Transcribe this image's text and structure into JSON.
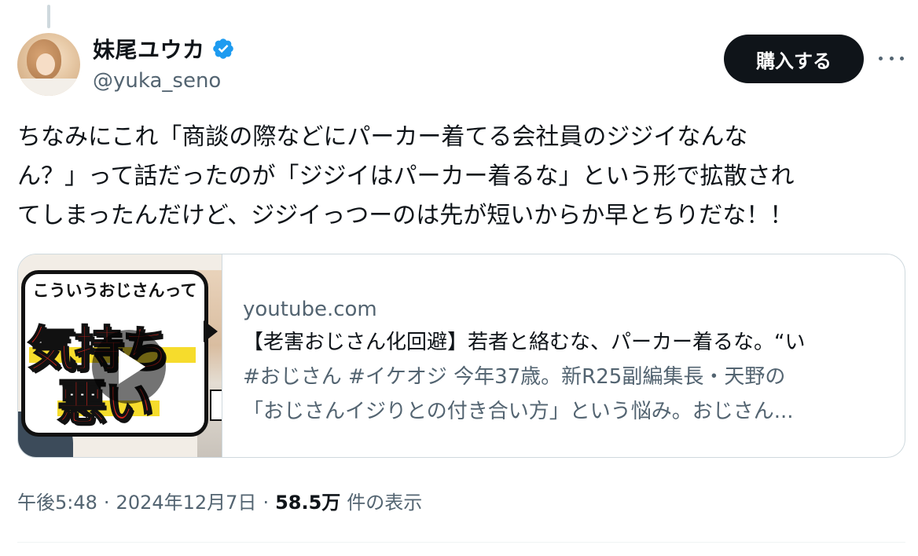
{
  "author": {
    "display_name": "妹尾ユウカ",
    "handle": "@yuka_seno",
    "verified": true
  },
  "header": {
    "buy_label": "購入する"
  },
  "tweet": {
    "lines": [
      "ちなみにこれ「商談の際などにパーカー着てる会社員のジジイなんな",
      "ん？」って話だったのが「ジジイはパーカー着るな」という形で拡散され",
      "てしまったんだけど、ジジイっつーのは先が短いからか早とちりだな！！"
    ]
  },
  "card": {
    "thumbnail_caption_small": "こういうおじさんって",
    "thumbnail_caption_big_1": "気持ち",
    "thumbnail_caption_big_2": "悪い",
    "domain": "youtube.com",
    "title": "【老害おじさん化回避】若者と絡むな、パーカー着るな。“い",
    "description_line_1": "#おじさん #イケオジ 今年37歳。新R25副編集長・天野の",
    "description_line_2": "「おじさんイジりとの付き合い方」という悩み。おじさん..."
  },
  "meta": {
    "time": "午後5:48",
    "separator": "·",
    "date": "2024年12月7日",
    "views_count": "58.5万",
    "views_label": "件の表示"
  },
  "colors": {
    "verified_blue": "#1d9bf0",
    "text_primary": "#0f1419",
    "text_secondary": "#536471",
    "button_bg": "#0f1419"
  }
}
